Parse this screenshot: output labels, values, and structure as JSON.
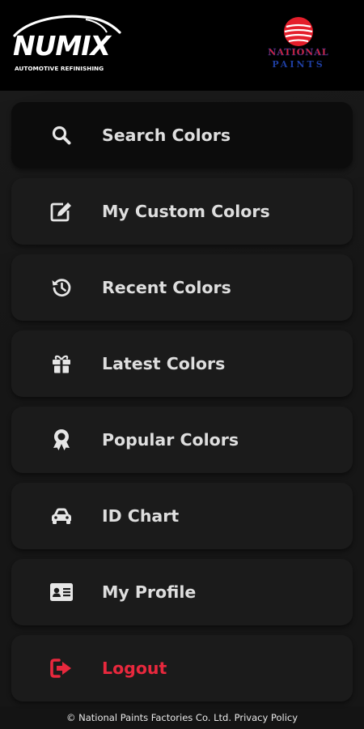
{
  "header": {
    "brand_left": {
      "name": "NUMIX",
      "tagline": "AUTOMOTIVE REFINISHING"
    },
    "brand_right": {
      "name": "NATIONAL",
      "subname": "PAINTS",
      "colors": {
        "red": "#e41e2b",
        "blue": "#1e3ea0"
      }
    }
  },
  "menu": {
    "items": [
      {
        "label": "Search Colors",
        "icon": "search-icon",
        "active": true
      },
      {
        "label": "My Custom Colors",
        "icon": "edit-icon",
        "active": false
      },
      {
        "label": "Recent Colors",
        "icon": "history-icon",
        "active": false
      },
      {
        "label": "Latest Colors",
        "icon": "gift-icon",
        "active": false
      },
      {
        "label": "Popular Colors",
        "icon": "award-icon",
        "active": false
      },
      {
        "label": "ID Chart",
        "icon": "car-icon",
        "active": false
      },
      {
        "label": "My Profile",
        "icon": "id-card-icon",
        "active": false
      },
      {
        "label": "Logout",
        "icon": "logout-icon",
        "active": false
      }
    ],
    "colors": {
      "text": "#dedede",
      "logout": "#e8283d",
      "item_bg": "#1b1b1b"
    }
  },
  "footer": {
    "copyright": "© National Paints Factories Co. Ltd.",
    "privacy_link": "Privacy Policy"
  }
}
